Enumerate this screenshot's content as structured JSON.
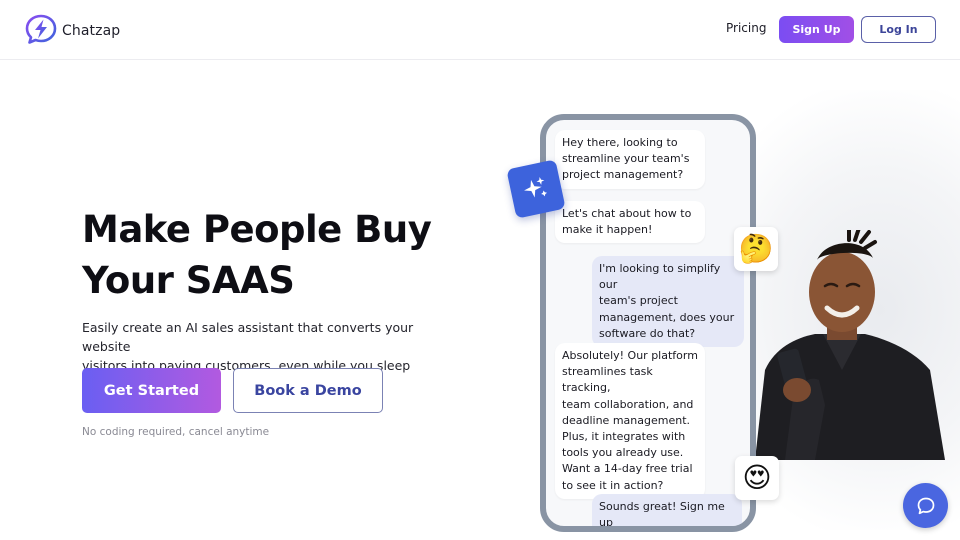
{
  "header": {
    "brand": "Chatzap",
    "nav_pricing": "Pricing",
    "signup_label": "Sign Up",
    "login_label": "Log In"
  },
  "hero": {
    "title_line1": "Make People Buy",
    "title_line2": "Your SAAS",
    "subtitle_line1": "Easily create an AI sales assistant that converts your website",
    "subtitle_line2": "visitors into paying customers, even while you sleep",
    "cta_primary": "Get Started",
    "cta_secondary": "Book a Demo",
    "note": "No coding required, cancel anytime"
  },
  "chat": {
    "messages": [
      {
        "role": "bot",
        "lines": [
          "Hey there, looking to",
          "streamline your team's",
          "project management?"
        ]
      },
      {
        "role": "bot",
        "lines": [
          "Let's chat about how to",
          "make it happen!"
        ]
      },
      {
        "role": "user",
        "lines": [
          "I'm looking to simplify our",
          "team's project",
          "management, does your",
          "software do that?"
        ]
      },
      {
        "role": "bot",
        "lines": [
          "Absolutely! Our platform",
          "streamlines task tracking,",
          "team collaboration, and",
          "deadline management.",
          "Plus, it integrates with",
          "tools you already use.",
          "Want a 14-day free trial",
          "to see it in action?"
        ]
      },
      {
        "role": "user",
        "lines": [
          "Sounds great! Sign me up"
        ]
      }
    ],
    "emoji_thinking": "🤔",
    "emoji_love": "😍"
  },
  "icons": {
    "logo": "chatzap-logo-icon",
    "sparkle": "sparkle-icon",
    "chat_widget": "chat-bubble-icon"
  },
  "colors": {
    "brand_purple": "#7b4df2",
    "brand_blue": "#4a66e0",
    "cta_gradient_start": "#6a5ff2",
    "cta_gradient_end": "#b25ae0"
  }
}
